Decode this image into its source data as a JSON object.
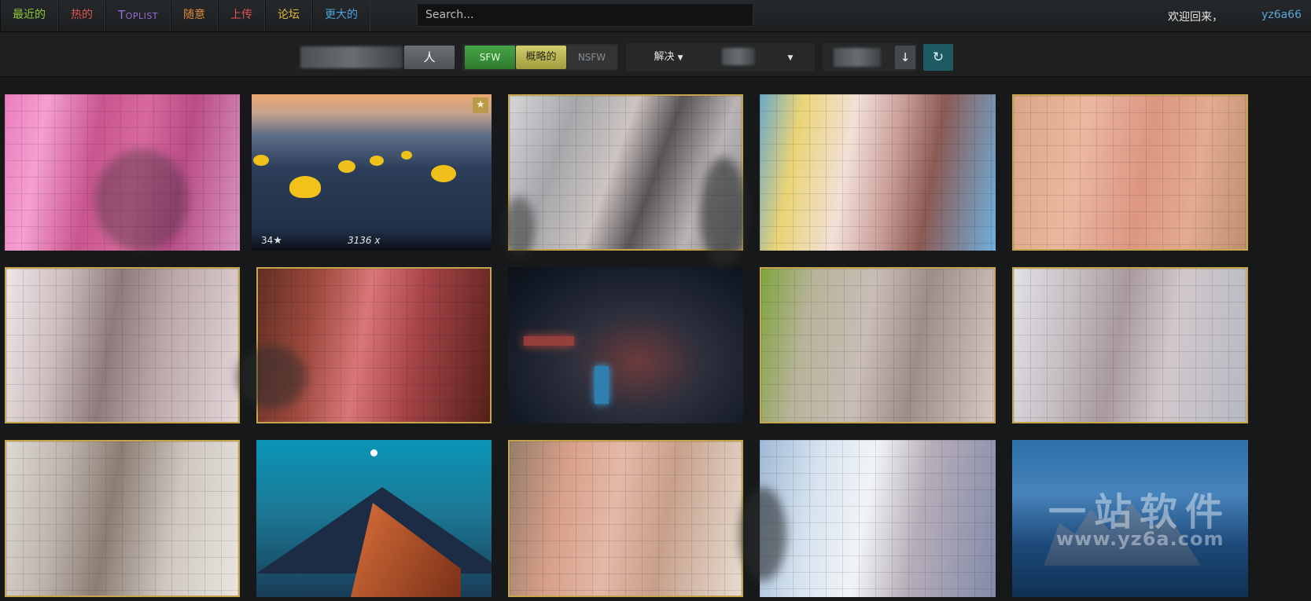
{
  "nav": {
    "items": [
      {
        "label": "最近的",
        "color": "#8fc93a"
      },
      {
        "label": "热的",
        "color": "#e05252"
      },
      {
        "label": "Toplist",
        "color": "#9b6ed3"
      },
      {
        "label": "随意",
        "color": "#e08a3a"
      },
      {
        "label": "上传",
        "color": "#e05252"
      },
      {
        "label": "论坛",
        "color": "#e0b83a"
      },
      {
        "label": "更大的",
        "color": "#4aa3df"
      }
    ],
    "search_placeholder": "Search..."
  },
  "user": {
    "welcome": "欢迎回来，",
    "name": "yz6a66"
  },
  "filters": {
    "people": "人",
    "purity": {
      "sfw": "SFW",
      "sketchy": "概略的",
      "nsfw": "NSFW"
    },
    "resolution": "解决",
    "ratio": "",
    "order_icon": "arrow-down-icon",
    "refresh_icon": "refresh-icon"
  },
  "thumbs": [
    {
      "id": "t1",
      "favorite": false,
      "palette": "pink"
    },
    {
      "id": "t2",
      "favorite": false,
      "palette": "ducks",
      "favorites_count": "34",
      "resolution": "3136 x"
    },
    {
      "id": "t3",
      "favorite": true,
      "palette": "grey-anime"
    },
    {
      "id": "t4",
      "favorite": false,
      "palette": "anime-sky"
    },
    {
      "id": "t5",
      "favorite": true,
      "palette": "skin"
    },
    {
      "id": "t6",
      "favorite": true,
      "palette": "grey-pink"
    },
    {
      "id": "t7",
      "favorite": true,
      "palette": "red-brown"
    },
    {
      "id": "t8",
      "favorite": false,
      "palette": "night-street"
    },
    {
      "id": "t9",
      "favorite": true,
      "palette": "green-skin"
    },
    {
      "id": "t10",
      "favorite": true,
      "palette": "grey-skin"
    },
    {
      "id": "t11",
      "favorite": true,
      "palette": "grey-room"
    },
    {
      "id": "t12",
      "favorite": false,
      "palette": "dune"
    },
    {
      "id": "t13",
      "favorite": true,
      "palette": "warm-skin"
    },
    {
      "id": "t14",
      "favorite": false,
      "palette": "blue-skin"
    },
    {
      "id": "t15",
      "favorite": false,
      "palette": "blue-castle"
    }
  ],
  "watermark": {
    "text": "一站软件",
    "url": "www.yz6a.com"
  }
}
